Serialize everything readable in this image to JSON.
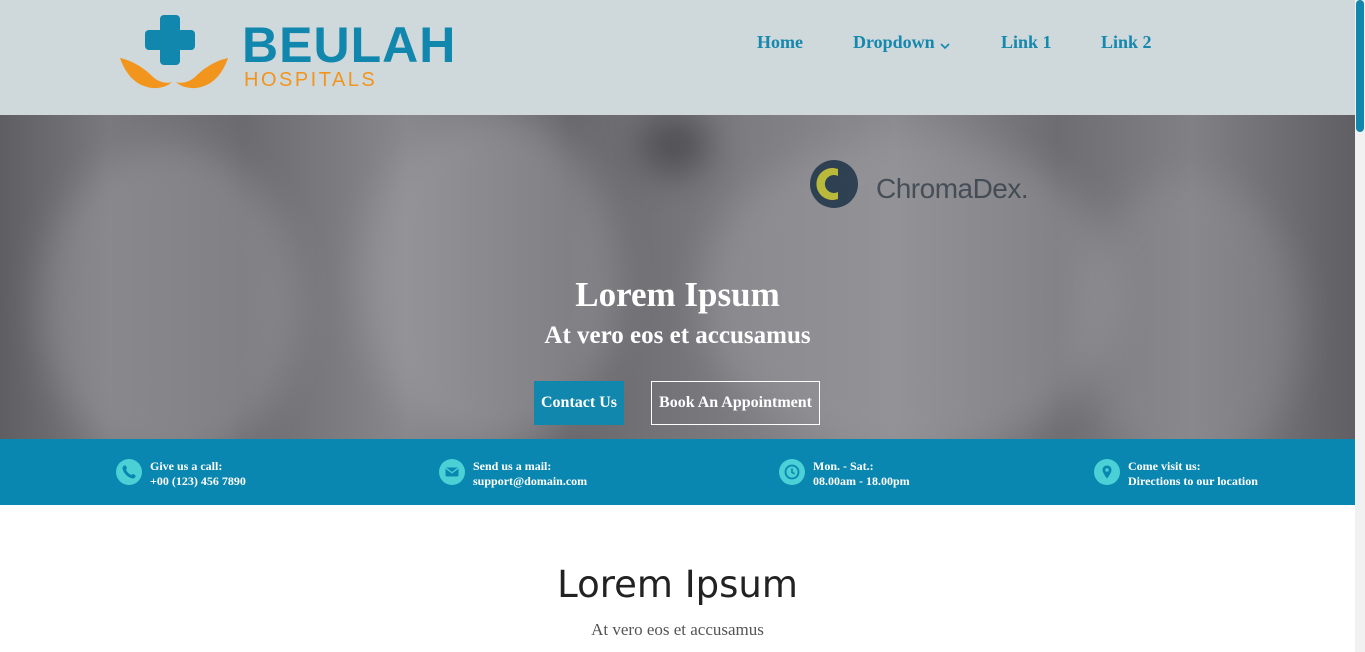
{
  "brand": {
    "name": "BEULAH",
    "subtitle": "HOSPITALS",
    "colors": {
      "blue": "#1287ad",
      "orange": "#f2951d"
    }
  },
  "nav": {
    "items": [
      {
        "label": "Home"
      },
      {
        "label": "Dropdown",
        "icon": "chevron-down-icon"
      },
      {
        "label": "Link 1"
      },
      {
        "label": "Link 2"
      }
    ]
  },
  "hero": {
    "background_brand": "ChromaDex.",
    "title": "Lorem Ipsum",
    "subtitle": "At vero eos et accusamus",
    "primary_button": "Contact Us",
    "secondary_button": "Book An Appointment"
  },
  "info": [
    {
      "icon": "phone-icon",
      "label": "Give us a call:",
      "value": "+00 (123) 456 7890"
    },
    {
      "icon": "mail-icon",
      "label": "Send us a mail:",
      "value": "support@domain.com"
    },
    {
      "icon": "clock-icon",
      "label": "Mon. - Sat.:",
      "value": "08.00am - 18.00pm"
    },
    {
      "icon": "location-pin-icon",
      "label": "Come visit us:",
      "value": "Directions to our location"
    }
  ],
  "section": {
    "title": "Lorem Ipsum",
    "subtitle": "At vero eos et accusamus"
  },
  "colors": {
    "accent": "#0a87b0",
    "header_bg": "#cfd8db",
    "icon_circle": "#4bd0d6"
  }
}
